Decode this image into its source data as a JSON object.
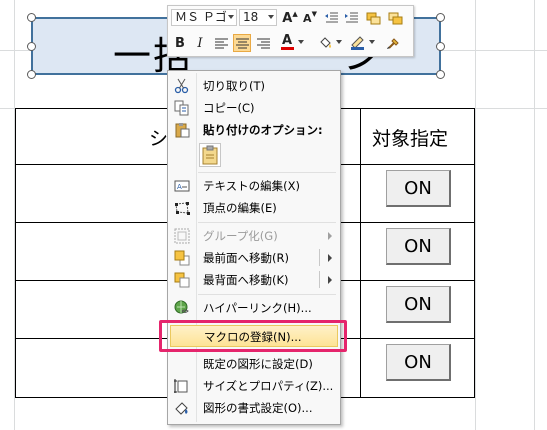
{
  "table": {
    "header_shape_col": "シ",
    "header_target_col": "対象指定",
    "rows": [
      {
        "button": "ON"
      },
      {
        "button": "ON"
      },
      {
        "button": "ON"
      },
      {
        "button": "ON"
      }
    ]
  },
  "title_shape": {
    "text": "一括",
    "text_tail": "ン"
  },
  "mini_toolbar": {
    "font_name": "ＭＳ Ｐゴ",
    "font_size": "18",
    "grow_font": "A",
    "shrink_font": "A",
    "bold": "B",
    "italic": "I",
    "font_color": "A"
  },
  "context_menu": {
    "items": [
      {
        "label": "切り取り(T)",
        "icon": "scissors-icon",
        "enabled": true
      },
      {
        "label": "コピー(C)",
        "icon": "copy-icon",
        "enabled": true
      },
      {
        "label": "貼り付けのオプション:",
        "icon": "paste-icon",
        "enabled": true,
        "bold": true
      },
      {
        "label": "テキストの編集(X)",
        "icon": "edit-text-icon",
        "enabled": true
      },
      {
        "label": "頂点の編集(E)",
        "icon": "edit-points-icon",
        "enabled": true
      },
      {
        "label": "グループ化(G)",
        "icon": "group-icon",
        "enabled": false
      },
      {
        "label": "最前面へ移動(R)",
        "icon": "bring-front-icon",
        "enabled": true
      },
      {
        "label": "最背面へ移動(K)",
        "icon": "send-back-icon",
        "enabled": true
      },
      {
        "label": "ハイパーリンク(H)...",
        "icon": "hyperlink-icon",
        "enabled": true
      },
      {
        "label": "マクロの登録(N)...",
        "icon": "",
        "enabled": true,
        "highlighted": true
      },
      {
        "label": "既定の図形に設定(D)",
        "icon": "",
        "enabled": true
      },
      {
        "label": "サイズとプロパティ(Z)...",
        "icon": "size-properties-icon",
        "enabled": true
      },
      {
        "label": "図形の書式設定(O)...",
        "icon": "format-shape-icon",
        "enabled": true
      }
    ]
  },
  "colors": {
    "highlight_border": "#e5256c",
    "shape_fill": "#dde7f3",
    "shape_border": "#41719c"
  }
}
